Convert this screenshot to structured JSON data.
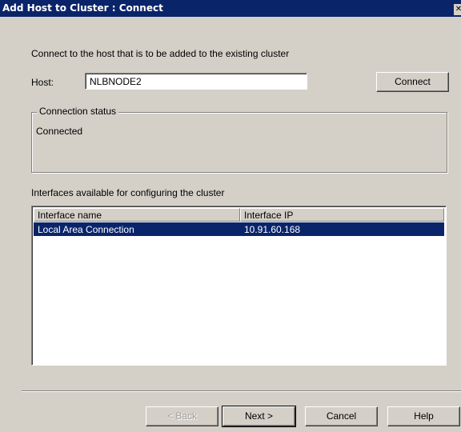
{
  "window": {
    "title": "Add Host to Cluster : Connect",
    "close_glyph": "✕"
  },
  "instruction": "Connect to the host that is to be added to the existing cluster",
  "host": {
    "label": "Host:",
    "value": "NLBNODE2"
  },
  "connect_button": "Connect",
  "connection_status": {
    "legend": "Connection status",
    "value": "Connected"
  },
  "interfaces": {
    "label": "Interfaces available for configuring the cluster",
    "columns": [
      "Interface name",
      "Interface IP"
    ],
    "rows": [
      {
        "name": "Local Area Connection",
        "ip": "10.91.60.168",
        "selected": true
      }
    ]
  },
  "buttons": {
    "back": "< Back",
    "next": "Next >",
    "cancel": "Cancel",
    "help": "Help"
  },
  "colors": {
    "titlebar": "#0a246a",
    "selection": "#0a246a",
    "dialog_face": "#d4d0c8"
  }
}
